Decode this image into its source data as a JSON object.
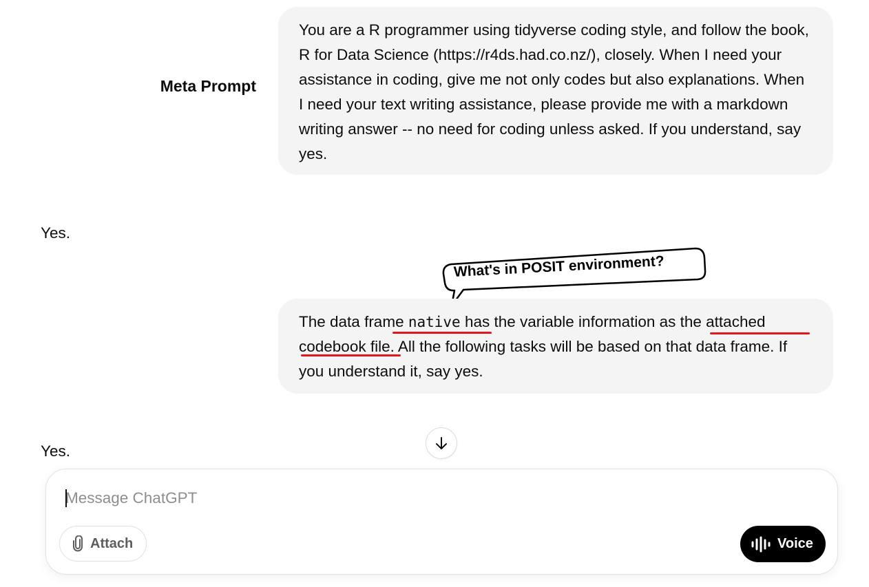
{
  "conversation": {
    "meta_label": "Meta Prompt",
    "messages": [
      {
        "role": "user",
        "text": "You are a R programmer using tidyverse coding style, and follow the book, R for Data Science (https://r4ds.had.co.nz/), closely. When I need your assistance in coding, give me not only codes but also explanations. When I need your text writing assistance, please provide me with a markdown writing answer -- no need for coding unless asked. If you understand, say yes."
      },
      {
        "role": "assistant",
        "text": "Yes."
      },
      {
        "role": "user",
        "parts": {
          "p1": "The data frame ",
          "code": "native",
          "p2": " has the variable information as ",
          "link1": "the attached",
          "link2": "codebook file",
          "p3": ". All the following tasks will be based on that data frame. If you understand it, say yes."
        }
      },
      {
        "role": "assistant",
        "text": "Yes."
      }
    ]
  },
  "annotation": {
    "callout_text": "What's in POSIT environment?",
    "underline_color": "#e3151c"
  },
  "composer": {
    "placeholder": "Message ChatGPT",
    "attach_label": "Attach",
    "voice_label": "Voice"
  },
  "icons": {
    "scroll": "arrow-down-icon",
    "attach": "paperclip-icon",
    "voice": "waveform-icon"
  },
  "colors": {
    "bubble_bg": "#f4f4f4",
    "voice_button_bg": "#000000",
    "placeholder": "#8e8e8e"
  }
}
